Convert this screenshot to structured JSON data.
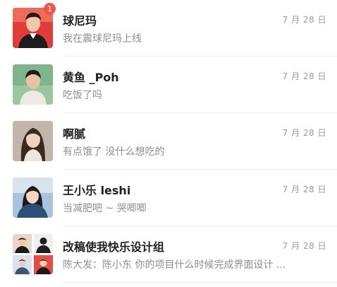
{
  "chats": [
    {
      "name": "球尼玛",
      "preview": "我在震球尼玛上线",
      "date": "7 月 28 日",
      "unread": "1",
      "avatar_icon": "person-photo-icon"
    },
    {
      "name": "黄鱼 _Poh",
      "preview": "吃饭了吗",
      "date": "7 月 28 日",
      "avatar_icon": "person-photo-icon"
    },
    {
      "name": "啊腻",
      "preview": "有点饿了 没什么想吃的",
      "date": "7 月 28 日",
      "avatar_icon": "person-photo-icon"
    },
    {
      "name": "王小乐 leshi",
      "preview": "当减肥吧 ~ 哭唧唧",
      "date": "7 月 28 日",
      "avatar_icon": "person-photo-icon"
    },
    {
      "name": "改稿使我快乐设计组",
      "preview": "陈大发：陈小东 你的项目什么时候完成界面设计 ...",
      "date": "7 月 28 日",
      "avatar_icon": "group-avatar-grid-icon"
    }
  ],
  "colors": {
    "badge": "#f4534d",
    "name": "#222222",
    "preview": "#8e8e8e",
    "date": "#9a9a9a",
    "divider": "#ececec"
  }
}
